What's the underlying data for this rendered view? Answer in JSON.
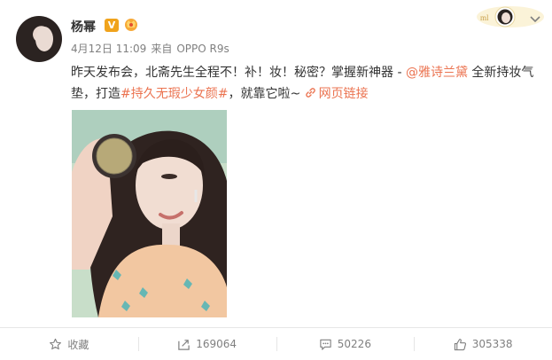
{
  "post": {
    "author": "杨幂",
    "verified_badge": "V",
    "time": "4月12日 11:09",
    "source_prefix": "来自",
    "source": "OPPO R9s",
    "text_part1": "昨天发布会，北斋先生全程不！补！妆！秘密？掌握新神器 - ",
    "mention": "@雅诗兰黛",
    "text_part2": " 全新持妆气垫，打造",
    "hashtag": "#持久无瑕少女颜#",
    "text_part3": "，就靠它啦~ ",
    "web_link": "网页链接"
  },
  "actions": {
    "favorite": "收藏",
    "repost": "169064",
    "comment": "50226",
    "like": "305338"
  },
  "icons": {
    "verified": "verified-v-icon",
    "member": "crown-member-icon",
    "link": "link-icon",
    "favorite": "star-icon",
    "repost": "repost-icon",
    "comment": "comment-icon",
    "like": "thumbs-up-icon",
    "more": "chevron-down-icon"
  },
  "colors": {
    "link": "#eb7350",
    "verified": "#f0a31c",
    "muted": "#808080"
  }
}
